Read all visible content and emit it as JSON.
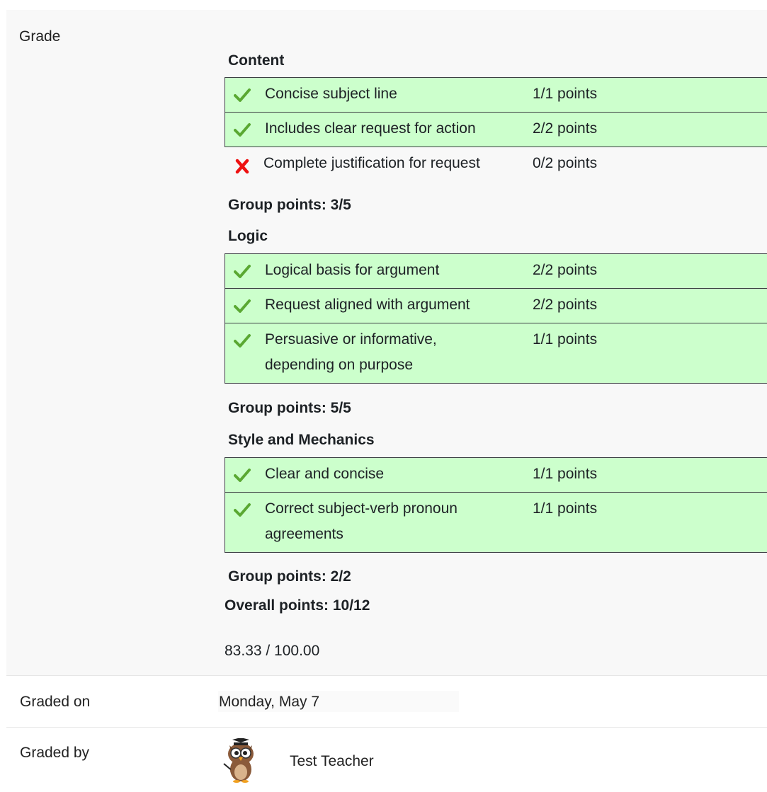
{
  "grade_label": "Grade",
  "groups": [
    {
      "title": "Content",
      "criteria": [
        {
          "desc": "Concise subject line",
          "points": "1/1 points",
          "status": "pass"
        },
        {
          "desc": "Includes clear request for action",
          "points": "2/2 points",
          "status": "pass"
        },
        {
          "desc": "Complete justification for request",
          "points": "0/2 points",
          "status": "fail"
        }
      ],
      "group_points": "Group points: 3/5"
    },
    {
      "title": "Logic",
      "criteria": [
        {
          "desc": "Logical basis for argument",
          "points": "2/2 points",
          "status": "pass"
        },
        {
          "desc": "Request aligned with argument",
          "points": "2/2 points",
          "status": "pass"
        },
        {
          "desc": "Persuasive or informative, depending on purpose",
          "points": "1/1 points",
          "status": "pass"
        }
      ],
      "group_points": "Group points: 5/5"
    },
    {
      "title": "Style and Mechanics",
      "criteria": [
        {
          "desc": "Clear and concise",
          "points": "1/1 points",
          "status": "pass"
        },
        {
          "desc": "Correct subject-verb pronoun agreements",
          "points": "1/1 points",
          "status": "pass"
        }
      ],
      "group_points": "Group points: 2/2"
    }
  ],
  "overall_points": "Overall points: 10/12",
  "final_grade": "83.33 / 100.00",
  "graded_on_label": "Graded on",
  "graded_on_value": "Monday, May 7",
  "graded_by_label": "Graded by",
  "grader_name": "Test Teacher",
  "icons": {
    "pass": "check-icon",
    "fail": "cross-icon"
  },
  "colors": {
    "pass_bg": "#ccffcc",
    "check": "#5aa832",
    "cross": "#ee1111"
  }
}
